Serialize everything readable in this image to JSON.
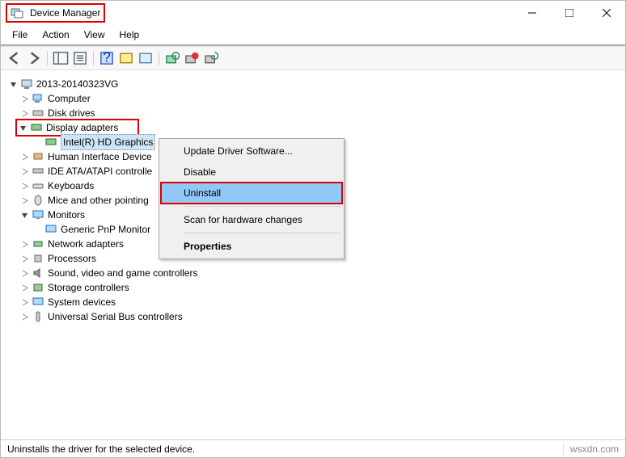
{
  "window": {
    "title": "Device Manager"
  },
  "menu": {
    "file": "File",
    "action": "Action",
    "view": "View",
    "help": "Help"
  },
  "tree": {
    "root": "2013-20140323VG",
    "nodes": {
      "computer": "Computer",
      "disk": "Disk drives",
      "display": "Display adapters",
      "intel": "Intel(R) HD Graphics",
      "hid": "Human Interface Device",
      "ide": "IDE ATA/ATAPI controlle",
      "keyboards": "Keyboards",
      "mice": "Mice and other pointing",
      "monitors": "Monitors",
      "genericpnp": "Generic PnP Monitor",
      "network": "Network adapters",
      "processors": "Processors",
      "sound": "Sound, video and game controllers",
      "storage": "Storage controllers",
      "system": "System devices",
      "usb": "Universal Serial Bus controllers"
    }
  },
  "context": {
    "update": "Update Driver Software...",
    "disable": "Disable",
    "uninstall": "Uninstall",
    "scan": "Scan for hardware changes",
    "properties": "Properties"
  },
  "status": {
    "text": "Uninstalls the driver for the selected device.",
    "watermark": "wsxdn.com"
  }
}
